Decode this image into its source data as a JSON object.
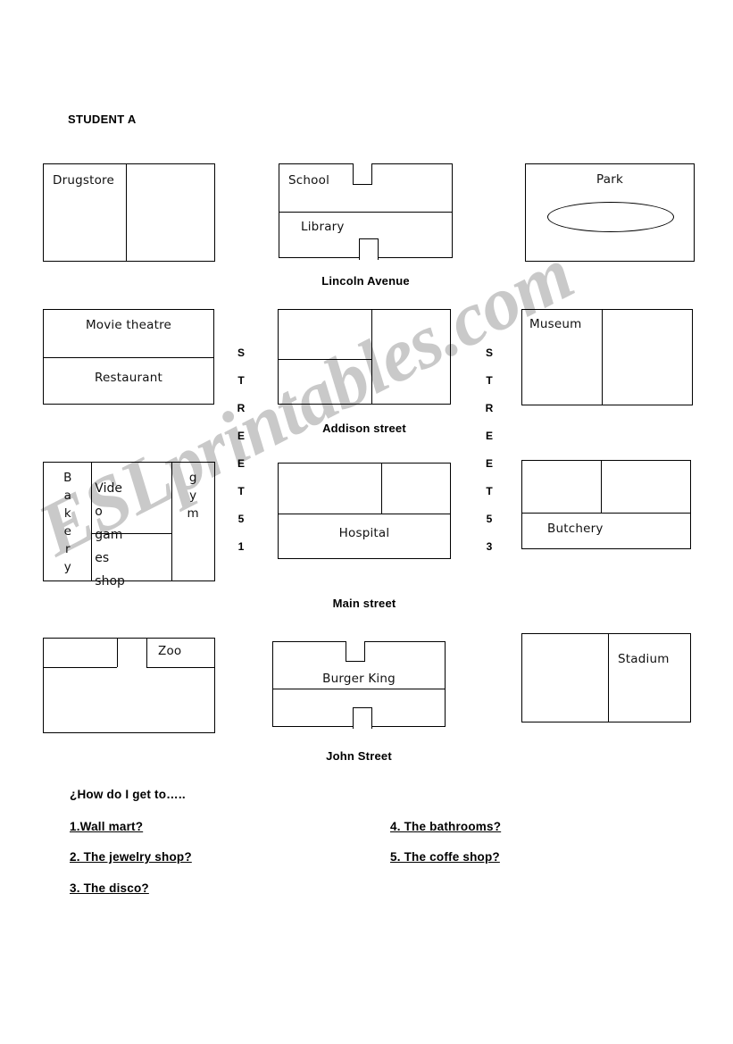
{
  "document": {
    "title": "STUDENT  A",
    "watermark": "ESLprintables.com"
  },
  "map": {
    "blocks": [
      {
        "id": "drugstore",
        "labels": [
          "Drugstore"
        ]
      },
      {
        "id": "school-library",
        "labels": [
          "School",
          "Library"
        ]
      },
      {
        "id": "park",
        "labels": [
          "Park"
        ]
      },
      {
        "id": "movie-restaurant",
        "labels": [
          "Movie theatre",
          "Restaurant"
        ]
      },
      {
        "id": "addison-block",
        "labels": []
      },
      {
        "id": "museum",
        "labels": [
          "Museum"
        ]
      },
      {
        "id": "bakery-video-gym",
        "labels": [
          "Bakery",
          "Video games shop",
          "gym"
        ],
        "bakery_letters": "B a k e r y",
        "gym_letters": "g y m",
        "video_line_1": "Vide",
        "video_line_2": "o",
        "video_line_3": "gam",
        "video_line_4": "es",
        "video_line_5": "shop"
      },
      {
        "id": "hospital",
        "labels": [
          "Hospital"
        ]
      },
      {
        "id": "butchery",
        "labels": [
          "Butchery"
        ]
      },
      {
        "id": "zoo",
        "labels": [
          "Zoo"
        ]
      },
      {
        "id": "burger-king",
        "labels": [
          "Burger King"
        ]
      },
      {
        "id": "stadium",
        "labels": [
          "Stadium"
        ]
      }
    ],
    "block_labels": {
      "drugstore": "Drugstore",
      "school": "School",
      "library": "Library",
      "park": "Park",
      "movie_theatre": "Movie theatre",
      "restaurant": "Restaurant",
      "museum": "Museum",
      "hospital": "Hospital",
      "butchery": "Butchery",
      "zoo": "Zoo",
      "burger_king": "Burger King",
      "stadium": "Stadium",
      "bakery": "B\na\nk\ne\nr\ny",
      "gym": "g\ny\nm",
      "video_games_a": "Vide",
      "video_games_b": "o",
      "video_games_c": "gam",
      "video_games_d": "es",
      "video_games_e": "shop"
    },
    "streets": {
      "lincoln_avenue": "Lincoln Avenue",
      "addison_street": "Addison street",
      "main_street": "Main street",
      "john_street": "John Street",
      "street_51": "S\nT\nR\nE\nE\nT\n5\n1",
      "street_53": "S\nT\nR\nE\nE\nT\n5\n3",
      "street_51_chars": [
        "S",
        "T",
        "R",
        "E",
        "E",
        "T",
        "5",
        "1"
      ],
      "street_53_chars": [
        "S",
        "T",
        "R",
        "E",
        "E",
        "T",
        "5",
        "3"
      ]
    }
  },
  "questions": {
    "prompt": "¿How do I get to…..",
    "items": [
      {
        "text": "1.Wall mart?"
      },
      {
        "text": "2. The jewelry shop?"
      },
      {
        "text": "3. The disco?"
      },
      {
        "text": "4. The bathrooms?"
      },
      {
        "text": "5. The coffe shop?"
      }
    ]
  },
  "colors": {
    "ink": "#000000",
    "paper": "#ffffff",
    "watermark": "#c9c9c9"
  }
}
